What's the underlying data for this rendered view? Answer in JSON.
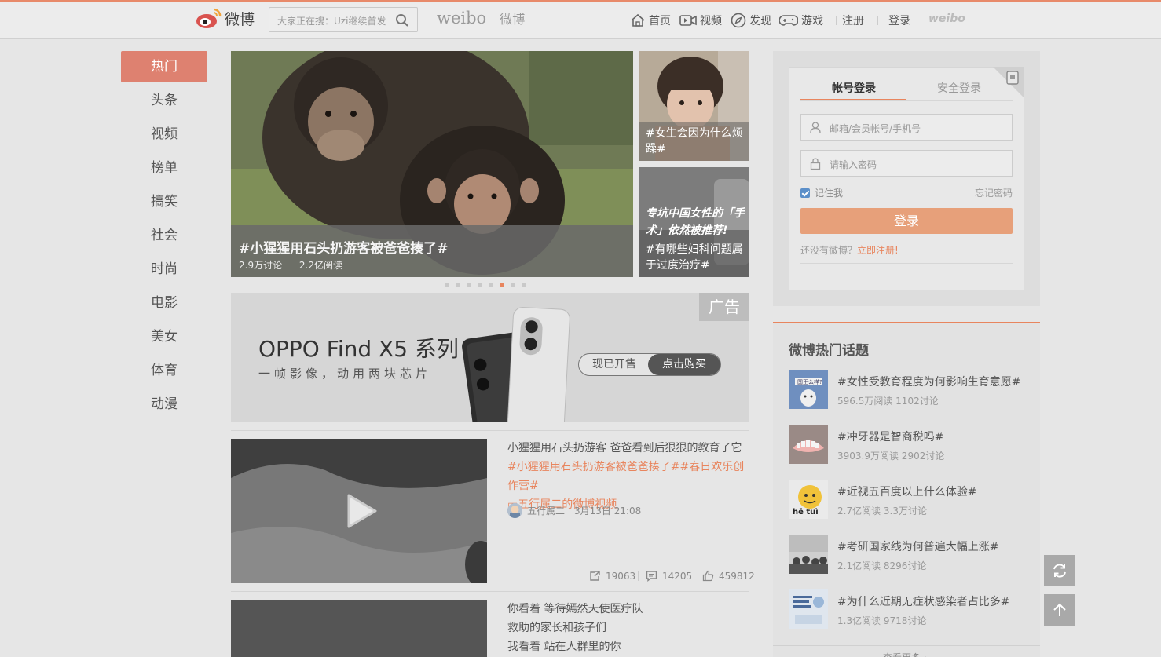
{
  "header": {
    "logo_text": "微博",
    "search_placeholder": "大家正在搜：Uzi继续首发",
    "brand_en": "weibo",
    "brand_cn": "微博",
    "nav": [
      {
        "label": "首页",
        "icon": "home-icon"
      },
      {
        "label": "视频",
        "icon": "video-icon"
      },
      {
        "label": "发现",
        "icon": "discover-icon"
      },
      {
        "label": "游戏",
        "icon": "game-icon"
      }
    ],
    "register": "注册",
    "login": "登录",
    "weibo_small": "weibo"
  },
  "sidebar": {
    "items": [
      "热门",
      "头条",
      "视频",
      "榜单",
      "搞笑",
      "社会",
      "时尚",
      "电影",
      "美女",
      "体育",
      "动漫"
    ],
    "active_index": 0
  },
  "carousel": {
    "main": {
      "title": "#小猩猩用石头扔游客被爸爸揍了#",
      "discussions": "2.9万讨论",
      "reads": "2.2亿阅读"
    },
    "side": [
      {
        "caption": "#女生会因为什么烦躁#"
      },
      {
        "overlay": "专坑中国女性的「手术」依然被推荐!",
        "caption": "#有哪些妇科问题属于过度治疗#"
      }
    ],
    "dots": 8,
    "active_dot": 5
  },
  "ad": {
    "brand": "OPPO Find X5 系列",
    "slogan": "一帧影像，动用两块芯片",
    "tag": "广告",
    "pill_left": "现已开售",
    "pill_right": "点击购买"
  },
  "posts": [
    {
      "text": "小猩猩用石头扔游客 爸爸看到后狠狠的教育了它",
      "tags": "#小猩猩用石头扔游客被爸爸揍了##春日欢乐创作营#",
      "video_link": "五行属二的微博视频",
      "author": "五行属二",
      "time": "3月13日 21:08",
      "shares": "19063",
      "comments": "14205",
      "likes": "459812"
    },
    {
      "lines": [
        "你看着 等待嫣然天使医疗队",
        "救助的家长和孩子们",
        "我看着 站在人群里的你"
      ]
    }
  ],
  "login": {
    "tab_account": "帐号登录",
    "tab_secure": "安全登录",
    "username_placeholder": "邮箱/会员帐号/手机号",
    "password_placeholder": "请输入密码",
    "remember": "记住我",
    "forgot": "忘记密码",
    "button": "登录",
    "no_account": "还没有微博？",
    "register_now": "立即注册!"
  },
  "hot_topics": {
    "title": "微博热门话题",
    "items": [
      {
        "title": "#女性受教育程度为何影响生育意愿#",
        "meta": "596.5万阅读 1102讨论",
        "thumb_text": "国王么样?"
      },
      {
        "title": "#冲牙器是智商税吗#",
        "meta": "3903.9万阅读 2902讨论"
      },
      {
        "title": "#近视五百度以上什么体验#",
        "meta": "2.7亿阅读 3.3万讨论",
        "thumb_text": "hē tuì"
      },
      {
        "title": "#考研国家线为何普遍大幅上涨#",
        "meta": "2.1亿阅读 8296讨论"
      },
      {
        "title": "#为什么近期无症状感染者占比多#",
        "meta": "1.3亿阅读 9718讨论"
      }
    ],
    "more": "查看更多 ›"
  },
  "colors": {
    "accent": "#e8855e",
    "sidebar_active": "#de8170"
  }
}
